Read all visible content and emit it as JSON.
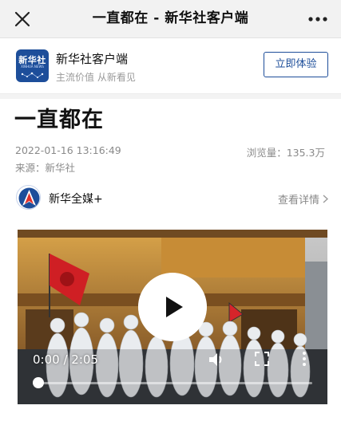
{
  "topbar": {
    "title": "一直都在 - 新华社客户端",
    "close_icon": "close-icon",
    "more_icon": "more-dots-icon"
  },
  "app_banner": {
    "logo_text": "新华社",
    "logo_subtext": "XINHUA NEWS",
    "name": "新华社客户端",
    "slogan": "主流价值 从新看见",
    "button_label": "立即体验",
    "brand_color": "#1d4e9a"
  },
  "article": {
    "title": "一直都在",
    "datetime": "2022-01-16 13:16:49",
    "views_label": "浏览量：",
    "views_value": "135.3万",
    "source_label": "来源：",
    "source_value": "新华社",
    "author": "新华全媒+",
    "detail_link": "查看详情"
  },
  "video": {
    "time_current": "0:00",
    "time_separator": " / ",
    "time_total": "2:05",
    "progress": 0,
    "play_icon": "play-icon",
    "volume_icon": "volume-icon",
    "fullscreen_icon": "fullscreen-icon",
    "menu_icon": "more-vertical-icon"
  }
}
